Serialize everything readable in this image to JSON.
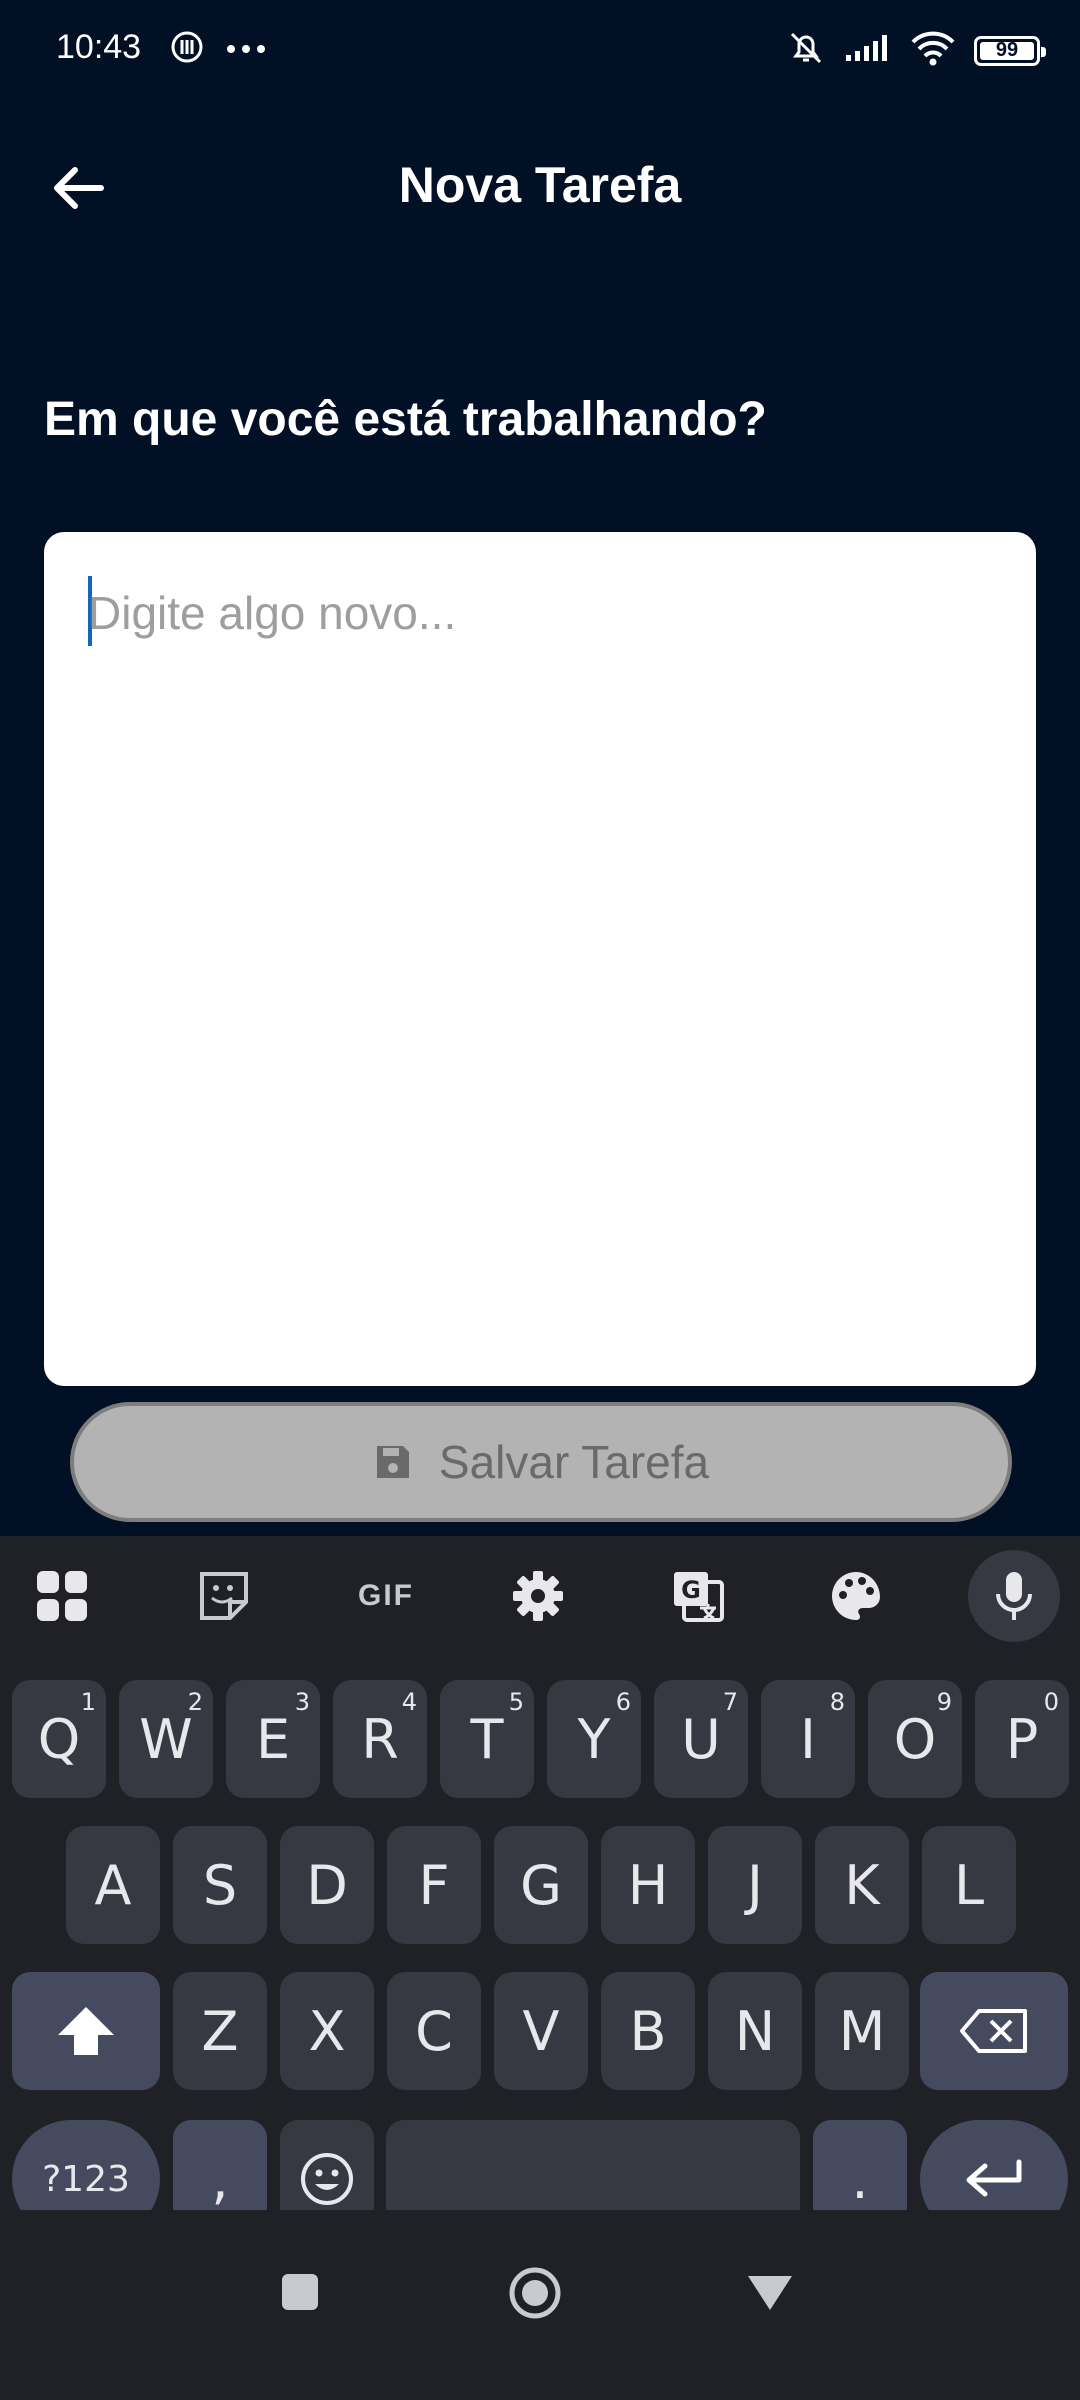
{
  "status": {
    "time": "10:43",
    "battery": "99",
    "icons": [
      "nfc-icon",
      "more-dots-icon",
      "bell-off-icon",
      "signal-icon",
      "wifi-icon",
      "battery-icon"
    ]
  },
  "app_bar": {
    "title": "Nova Tarefa"
  },
  "prompt": "Em que você está trabalhando?",
  "input": {
    "placeholder": "Digite algo novo..."
  },
  "save_button": {
    "label": "Salvar Tarefa"
  },
  "keyboard": {
    "toolbar": [
      "apps-grid-icon",
      "sticker-icon",
      "gif-icon",
      "settings-icon",
      "translate-icon",
      "palette-icon",
      "mic-icon"
    ],
    "gif_label": "GIF",
    "row1": [
      {
        "k": "Q",
        "n": "1"
      },
      {
        "k": "W",
        "n": "2"
      },
      {
        "k": "E",
        "n": "3"
      },
      {
        "k": "R",
        "n": "4"
      },
      {
        "k": "T",
        "n": "5"
      },
      {
        "k": "Y",
        "n": "6"
      },
      {
        "k": "U",
        "n": "7"
      },
      {
        "k": "I",
        "n": "8"
      },
      {
        "k": "O",
        "n": "9"
      },
      {
        "k": "P",
        "n": "0"
      }
    ],
    "row2": [
      "A",
      "S",
      "D",
      "F",
      "G",
      "H",
      "J",
      "K",
      "L"
    ],
    "row3": [
      "Z",
      "X",
      "C",
      "V",
      "B",
      "N",
      "M"
    ],
    "symbols_label": "?123",
    "comma": ",",
    "period": "."
  },
  "colors": {
    "background": "#011024",
    "keyboard": "#1f2126",
    "key": "#373942",
    "modifier_key": "#454a5e",
    "caret": "#1565c0"
  }
}
